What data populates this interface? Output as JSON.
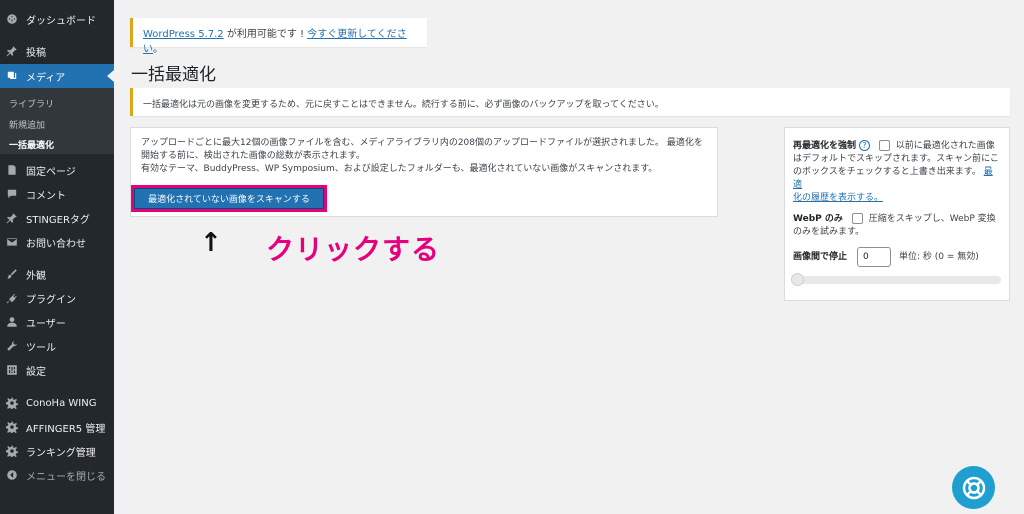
{
  "sidebar": {
    "dashboard": "ダッシュボード",
    "posts": "投稿",
    "media": "メディア",
    "submenu": {
      "library": "ライブラリ",
      "add_new": "新規追加",
      "bulk_optimize": "一括最適化"
    },
    "pages": "固定ページ",
    "comments": "コメント",
    "stinger_tags": "STINGERタグ",
    "contact": "お問い合わせ",
    "appearance": "外観",
    "plugins": "プラグイン",
    "users": "ユーザー",
    "tools": "ツール",
    "settings": "設定",
    "conoha_wing": "ConoHa WING",
    "affinger5": "AFFINGER5 管理",
    "ranking": "ランキング管理",
    "collapse": "メニューを閉じる"
  },
  "update_notice": {
    "version_link": "WordPress 5.7.2",
    "text": " が利用可能です ! ",
    "update_link": "今すぐ更新してください",
    "period": "。"
  },
  "page_title": "一括最適化",
  "warning": "一括最適化は元の画像を変更するため、元に戻すことはできません。続行する前に、必ず画像のバックアップを取ってください。",
  "scan_panel": {
    "line1": "アップロードごとに最大12個の画像ファイルを含む、メディアライブラリ内の208個のアップロードファイルが選択されました。 最適化を",
    "line2": "開始する前に、検出された画像の総数が表示されます。",
    "line3": "有効なテーマ、BuddyPress、WP Symposium、および設定したフォルダーも、最適化されていない画像がスキャンされます。",
    "button": "最適化されていない画像をスキャンする"
  },
  "annotation": {
    "arrow": "↑",
    "text": "クリックする"
  },
  "settings_panel": {
    "force_reoptimize_label": "再最適化を強制",
    "help": "?",
    "force_line1": "以前に最適化された画像",
    "force_line2": "はデフォルトでスキップされます。スキャン前にこ",
    "force_line3": "のボックスをチェックすると上書き出来ます。",
    "history_link_1": "最適",
    "history_link_2": "化の履歴を表示する。",
    "webp_label": "WebP のみ",
    "webp_line1": "圧縮をスキップし、WebP 変換",
    "webp_line2": "のみを試みます。",
    "delay_label": "画像間で停止",
    "delay_value": "0",
    "delay_unit": "単位: 秒 (0 = 無効)",
    "slider_value": 0
  },
  "colors": {
    "sidebar_bg": "#23282d",
    "accent": "#2271b1",
    "highlight": "#e6007e",
    "warning_border": "#dba617",
    "help_fab": "#1f9fcf"
  }
}
